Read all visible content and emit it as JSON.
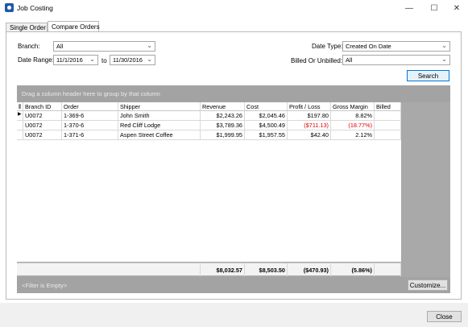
{
  "window": {
    "title": "Job Costing",
    "minimize": "—",
    "maximize": "☐",
    "close": "✕"
  },
  "tabs": [
    {
      "label": "Single Order"
    },
    {
      "label": "Compare Orders"
    }
  ],
  "filters": {
    "branch_label": "Branch:",
    "branch_value": "All",
    "date_range_label": "Date Range:",
    "date_from": "11/1/2016",
    "date_to_label": "to",
    "date_to": "11/30/2016",
    "date_type_label": "Date Type:",
    "date_type_value": "Created On Date",
    "billed_label": "Billed Or Unbilled:",
    "billed_value": "All",
    "search_label": "Search"
  },
  "grid": {
    "group_hint": "Drag a column header here to group by that column",
    "columns": [
      "Branch ID",
      "Order",
      "Shipper",
      "Revenue",
      "Cost",
      "Profit / Loss",
      "Gross Margin",
      "Billed"
    ],
    "rows": [
      {
        "branch_id": "U0072",
        "order": "1-369-6",
        "shipper": "John Smith",
        "revenue": "$2,243.26",
        "cost": "$2,045.46",
        "profit": "$197.80",
        "margin": "8.82%",
        "billed": ""
      },
      {
        "branch_id": "U0072",
        "order": "1-370-6",
        "shipper": "Red Cliff Lodge",
        "revenue": "$3,789.36",
        "cost": "$4,500.49",
        "profit": "($711.13)",
        "margin": "(18.77%)",
        "billed": ""
      },
      {
        "branch_id": "U0072",
        "order": "1-371-6",
        "shipper": "Aspen Street Coffee",
        "revenue": "$1,999.95",
        "cost": "$1,957.55",
        "profit": "$42.40",
        "margin": "2.12%",
        "billed": ""
      }
    ],
    "totals": {
      "revenue": "$8,032.57",
      "cost": "$8,503.50",
      "profit": "($470.93)",
      "margin": "(5.86%)"
    },
    "filter_text": "<Filter is Empty>",
    "customize_label": "Customize..."
  },
  "footer": {
    "close_label": "Close"
  },
  "colors": {
    "negative": "#e00000",
    "grid_chrome": "#a3a3a3",
    "accent": "#0078d7"
  }
}
